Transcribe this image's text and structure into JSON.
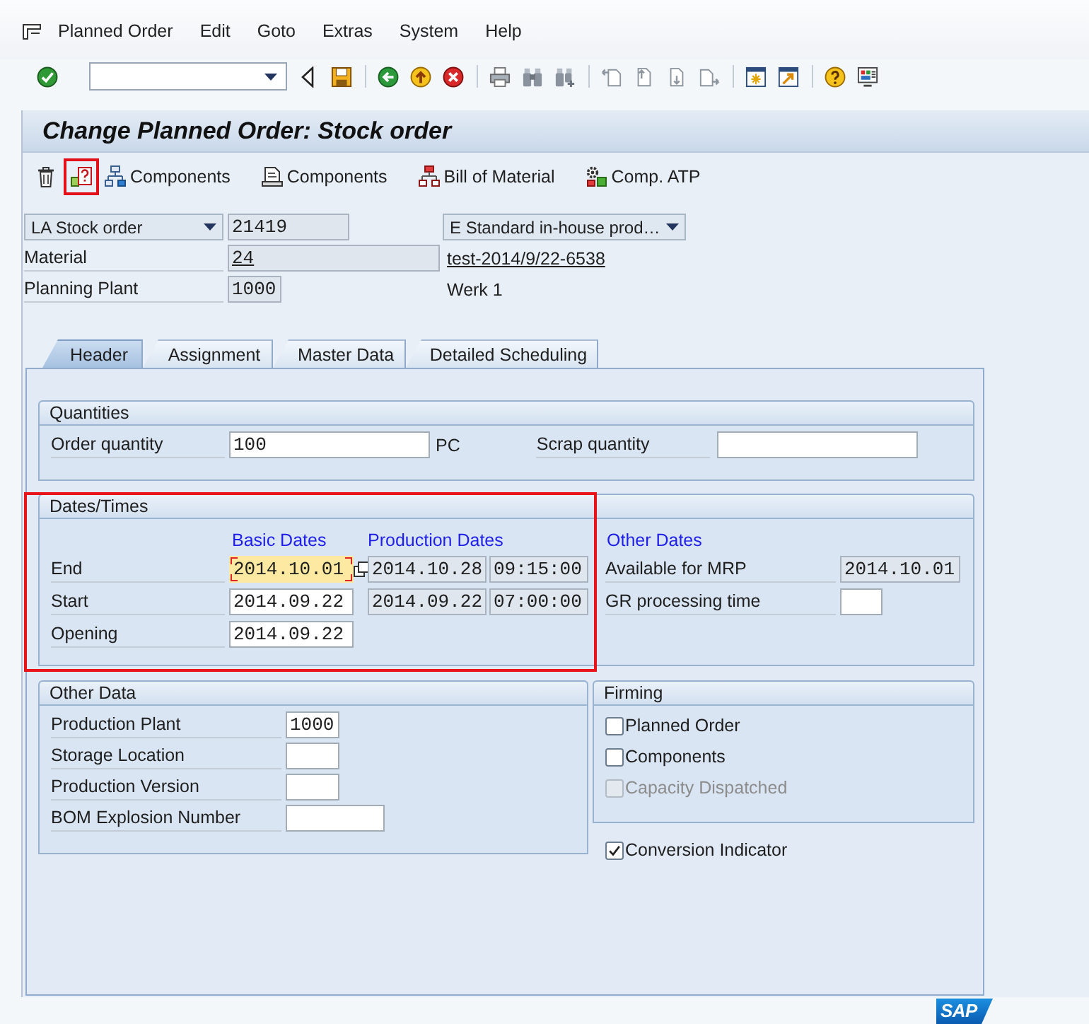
{
  "menu_bar": [
    "Planned Order",
    "Edit",
    "Goto",
    "Extras",
    "System",
    "Help"
  ],
  "title": "Change Planned Order: Stock order",
  "app_toolbar": [
    {
      "highlighted": false
    },
    {
      "highlighted": true
    },
    {
      "label": "Components",
      "highlighted": false
    },
    {
      "label": "Components",
      "highlighted": false
    },
    {
      "label": "Bill of Material",
      "highlighted": false
    },
    {
      "label": "Comp. ATP",
      "highlighted": false
    }
  ],
  "order": {
    "order_type": "LA Stock order",
    "order_number": {
      "value": "21419",
      "editable": false
    },
    "procurement_type": "E Standard in-house prod…",
    "material_label": "Material",
    "material": {
      "value": "24",
      "editable": false
    },
    "material_description": "test-2014/9/22-6538",
    "plant_label": "Planning Plant",
    "plant": {
      "value": "1000",
      "editable": false
    },
    "plant_name": "Werk 1"
  },
  "tabs": [
    {
      "label": "Header",
      "selected": true
    },
    {
      "label": "Assignment",
      "selected": false
    },
    {
      "label": "Master Data",
      "selected": false
    },
    {
      "label": "Detailed Scheduling",
      "selected": false
    }
  ],
  "quantities": {
    "title": "Quantities",
    "order_quantity_label": "Order quantity",
    "order_quantity": {
      "value": "100",
      "editable": true
    },
    "unit": "PC",
    "scrap_quantity_label": "Scrap quantity",
    "scrap_quantity": {
      "editable": true
    }
  },
  "dates_times": {
    "title": "Dates/Times",
    "highlighted": true,
    "basic_heading": "Basic Dates",
    "production_heading": "Production Dates",
    "other_heading": "Other Dates",
    "rows": [
      {
        "label": "End",
        "basic": {
          "value": "2014.10.01",
          "editable": true,
          "focused": true
        },
        "production_date": {
          "value": "2014.10.28",
          "editable": false
        },
        "production_time": {
          "value": "09:15:00",
          "editable": false
        },
        "other_label": "Available for MRP",
        "other": {
          "value": "2014.10.01",
          "editable": false
        }
      },
      {
        "label": "Start",
        "basic": {
          "value": "2014.09.22",
          "editable": true,
          "focused": false
        },
        "production_date": {
          "value": "2014.09.22",
          "editable": false
        },
        "production_time": {
          "value": "07:00:00",
          "editable": false
        },
        "other_label": "GR processing time",
        "other": {
          "editable": true
        }
      },
      {
        "label": "Opening",
        "basic": {
          "value": "2014.09.22",
          "editable": true,
          "focused": false
        }
      }
    ]
  },
  "other_data": {
    "title": "Other Data",
    "rows": [
      {
        "label": "Production Plant",
        "field": {
          "value": "1000",
          "editable": true
        }
      },
      {
        "label": "Storage Location",
        "field": {
          "editable": true
        }
      },
      {
        "label": "Production Version",
        "field": {
          "editable": true
        }
      },
      {
        "label": "BOM Explosion Number",
        "field": {
          "editable": true
        }
      }
    ]
  },
  "firming": {
    "title": "Firming",
    "options": [
      {
        "label": "Planned Order",
        "checked": false,
        "disabled": false
      },
      {
        "label": "Components",
        "checked": false,
        "disabled": false
      },
      {
        "label": "Capacity Dispatched",
        "checked": false,
        "disabled": true
      }
    ]
  },
  "conversion_indicator": {
    "label": "Conversion Indicator",
    "checked": true,
    "disabled": false
  },
  "logo": "SAP"
}
